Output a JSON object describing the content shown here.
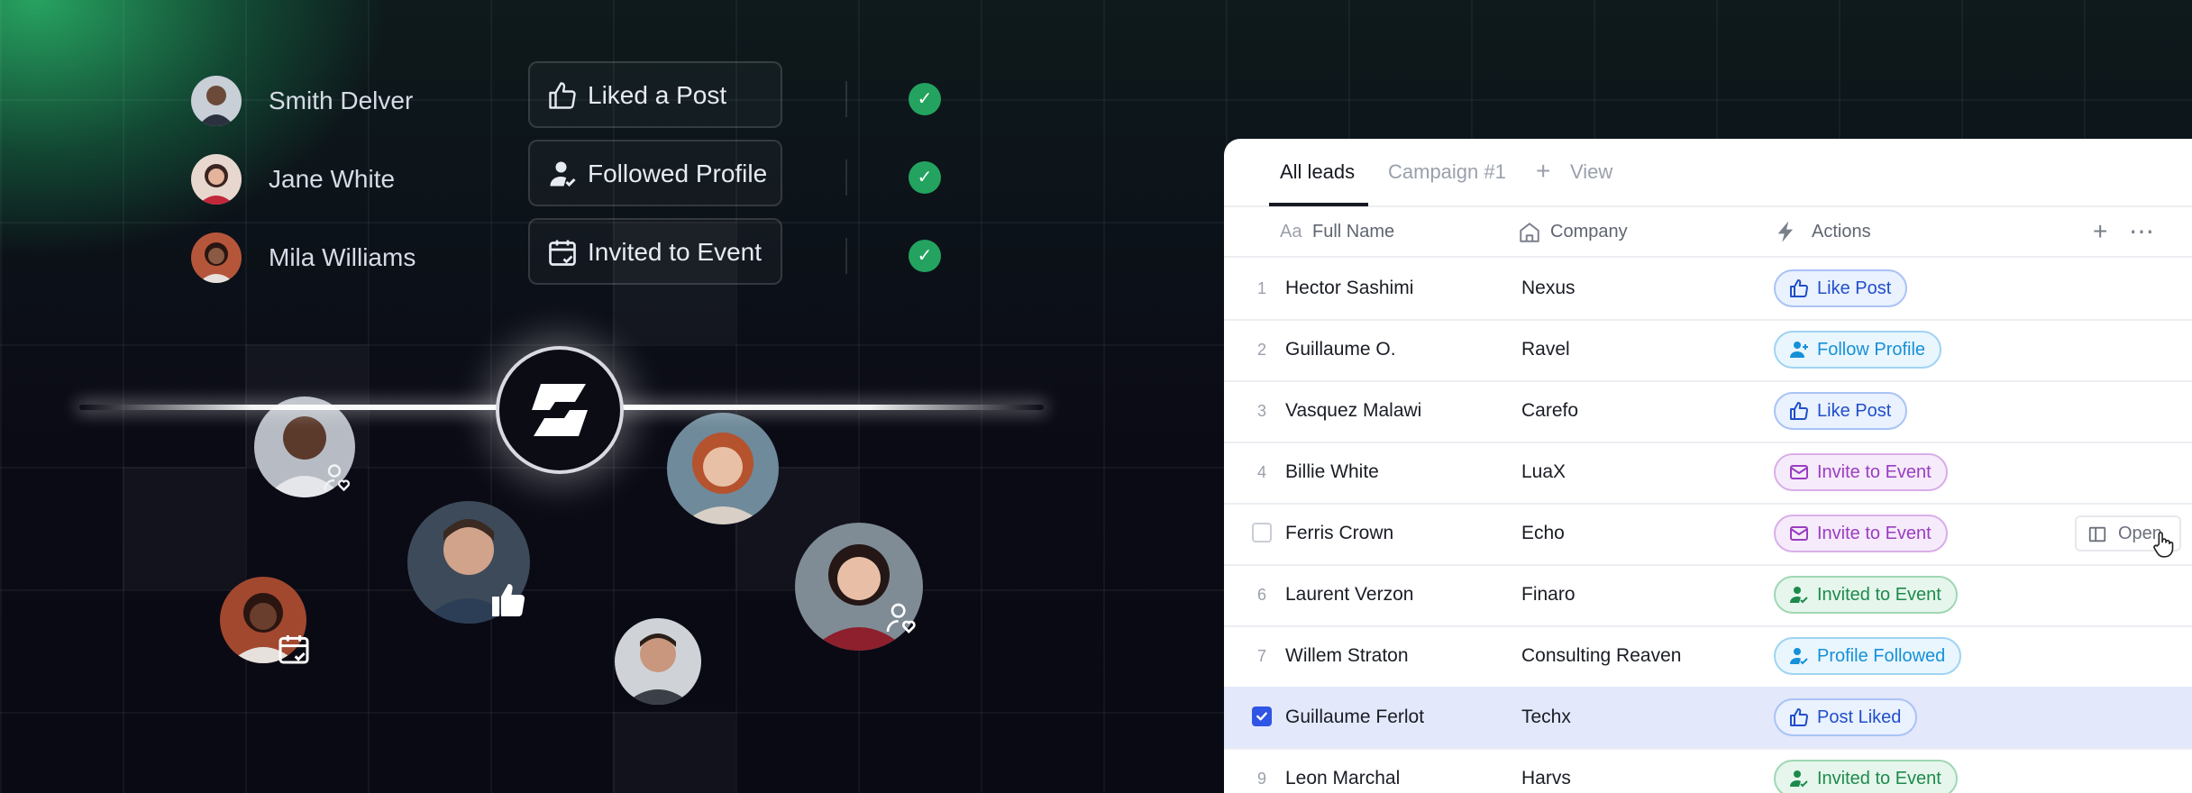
{
  "activity_feed": [
    {
      "name": "Smith Delver",
      "action": "Liked a Post",
      "icon": "thumbs-up-icon",
      "status": "done"
    },
    {
      "name": "Jane White",
      "action": "Followed Profile",
      "icon": "user-follow-icon",
      "status": "done"
    },
    {
      "name": "Mila Williams",
      "action": "Invited to Event",
      "icon": "calendar-check-icon",
      "status": "done"
    }
  ],
  "leads_panel": {
    "tabs": [
      {
        "label": "All leads",
        "active": true
      },
      {
        "label": "Campaign #1",
        "active": false
      },
      {
        "label": "View",
        "active": false
      }
    ],
    "columns": [
      {
        "icon": "text-field-icon",
        "icon_text": "Aa",
        "label": "Full Name"
      },
      {
        "icon": "building-icon",
        "label": "Company"
      },
      {
        "icon": "bolt-icon",
        "label": "Actions"
      }
    ],
    "rows": [
      {
        "num": "1",
        "name": "Hector Sashimi",
        "company": "Nexus",
        "action": "Like Post",
        "style": "blue",
        "icon": "thumbs-up-icon"
      },
      {
        "num": "2",
        "name": "Guillaume O.",
        "company": "Ravel",
        "action": "Follow Profile",
        "style": "sky",
        "icon": "user-plus-icon"
      },
      {
        "num": "3",
        "name": "Vasquez Malawi",
        "company": "Carefo",
        "action": "Like Post",
        "style": "blue",
        "icon": "thumbs-up-icon"
      },
      {
        "num": "4",
        "name": "Billie White",
        "company": "LuaX",
        "action": "Invite to Event",
        "style": "purple",
        "icon": "mail-icon"
      },
      {
        "num": "",
        "name": "Ferris Crown",
        "company": "Echo",
        "action": "Invite to Event",
        "style": "purple",
        "icon": "mail-icon",
        "checkbox": false,
        "hover": true
      },
      {
        "num": "6",
        "name": "Laurent Verzon",
        "company": "Finaro",
        "action": "Invited to Event",
        "style": "green",
        "icon": "user-check-icon"
      },
      {
        "num": "7",
        "name": "Willem Straton",
        "company": "Consulting Reaven",
        "action": "Profile Followed",
        "style": "sky",
        "icon": "user-check-icon"
      },
      {
        "num": "",
        "name": "Guillaume Ferlot",
        "company": "Techx",
        "action": "Post Liked",
        "style": "blue",
        "icon": "thumbs-up-icon",
        "checkbox": true,
        "selected": true
      },
      {
        "num": "9",
        "name": "Leon Marchal",
        "company": "Harvs",
        "action": "Invited to Event",
        "style": "green",
        "icon": "user-check-icon"
      }
    ],
    "open_button": "Open"
  },
  "colors": {
    "blue": "#1f4fc9",
    "sky": "#1690d8",
    "purple": "#9a3cc2",
    "green": "#1d8a4d",
    "check_green": "#23a35f",
    "selected_row": "#e3e8fb",
    "checkbox_on": "#2f55e4"
  }
}
